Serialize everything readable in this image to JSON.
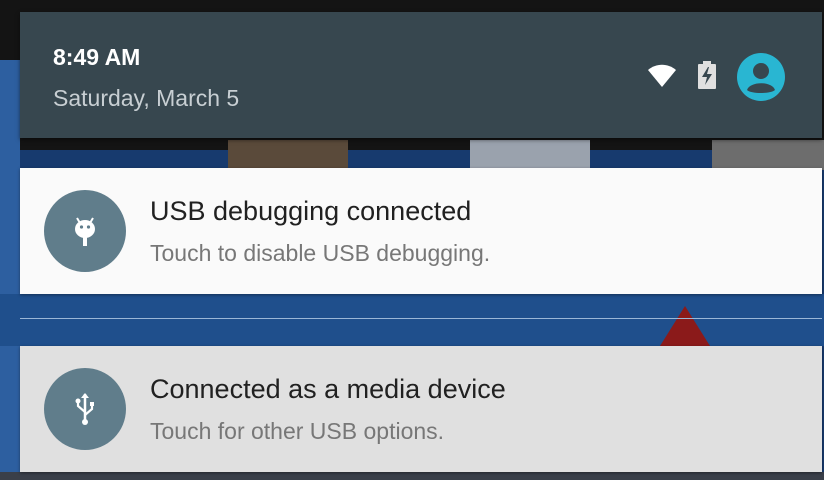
{
  "status_header": {
    "time": "8:49 AM",
    "date": "Saturday, March 5",
    "icons": [
      "wifi-icon",
      "battery-charging-icon",
      "user-account-icon"
    ],
    "accent_color": "#29b6d2"
  },
  "notifications": [
    {
      "icon": "android-debug-icon",
      "title": "USB debugging connected",
      "subtitle": "Touch to disable USB debugging."
    },
    {
      "icon": "usb-icon",
      "title": "Connected as a media device",
      "subtitle": "Touch for other USB options."
    }
  ],
  "colors": {
    "header_bg": "#37474f",
    "icon_circle": "#607d8b",
    "card_bg": "#fafafa",
    "card_pressed_bg": "#e0e0e0"
  }
}
